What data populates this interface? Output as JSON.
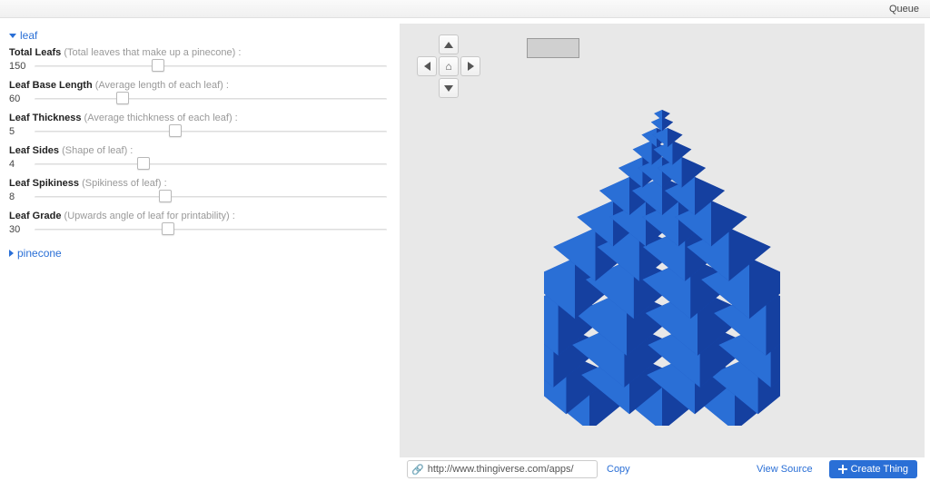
{
  "topbar": {
    "queue_label": "Queue"
  },
  "sections": {
    "leaf": {
      "title": "leaf",
      "expanded": true
    },
    "pinecone": {
      "title": "pinecone",
      "expanded": false
    }
  },
  "params": [
    {
      "label": "Total Leafs",
      "hint": "(Total leaves that make up a pinecone) :",
      "value": "150",
      "thumb_pct": 35
    },
    {
      "label": "Leaf Base Length",
      "hint": "(Average length of each leaf) :",
      "value": "60",
      "thumb_pct": 25
    },
    {
      "label": "Leaf Thickness",
      "hint": "(Average thichkness of each leaf) :",
      "value": "5",
      "thumb_pct": 40
    },
    {
      "label": "Leaf Sides",
      "hint": "(Shape of leaf) :",
      "value": "4",
      "thumb_pct": 31
    },
    {
      "label": "Leaf Spikiness",
      "hint": "(Spikiness of leaf) :",
      "value": "8",
      "thumb_pct": 37
    },
    {
      "label": "Leaf Grade",
      "hint": "(Upwards angle of leaf for printability) :",
      "value": "30",
      "thumb_pct": 38
    }
  ],
  "footer": {
    "url": "http://www.thingiverse.com/apps/",
    "copy_label": "Copy",
    "view_source_label": "View Source",
    "create_label": "Create Thing"
  },
  "colors": {
    "accent": "#2a6fd6",
    "model": "#1b4fbf",
    "viewer_bg": "#e8e8e8"
  }
}
